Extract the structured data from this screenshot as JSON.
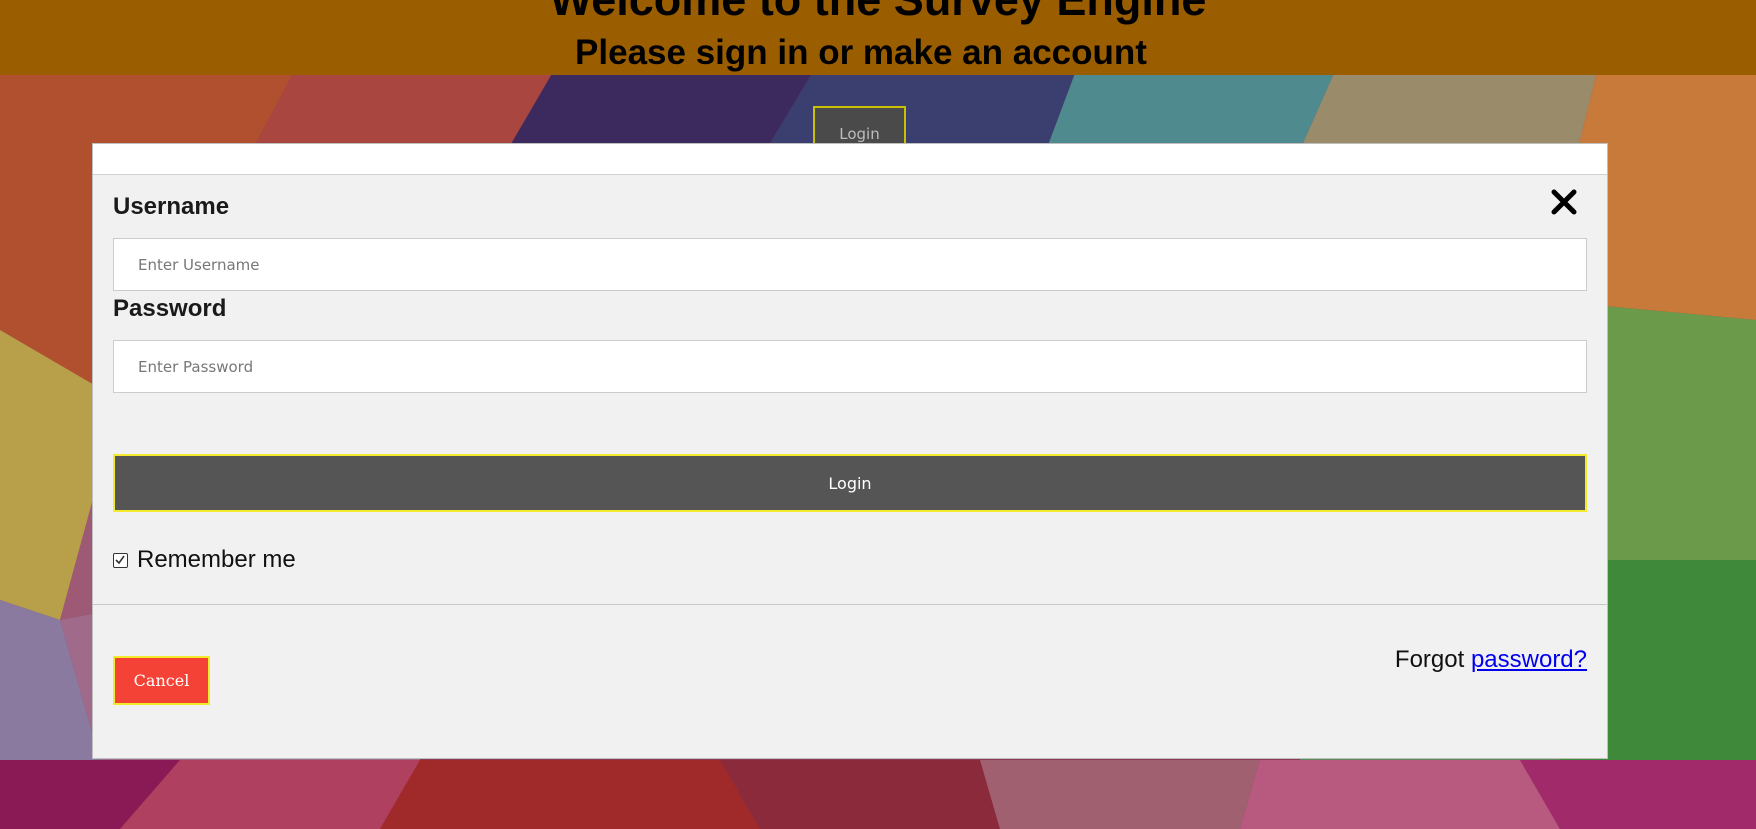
{
  "header": {
    "title": "Welcome to the Survey Engine",
    "subtitle": "Please sign in or make an account"
  },
  "background_login_button": "Login",
  "modal": {
    "username_label": "Username",
    "username_placeholder": "Enter Username",
    "password_label": "Password",
    "password_placeholder": "Enter Password",
    "login_button": "Login",
    "remember_label": "Remember me",
    "remember_checked": true,
    "cancel_button": "Cancel",
    "forgot_prefix": "Forgot ",
    "forgot_link": "password?"
  },
  "colors": {
    "header_bar": "#9a5e00",
    "login_button": "#555555",
    "cancel_button": "#f44336",
    "button_border": "#f2ea2a",
    "link": "#0000ee"
  },
  "icons": {
    "close": "close-icon",
    "checkbox": "checkbox-checked-icon"
  }
}
